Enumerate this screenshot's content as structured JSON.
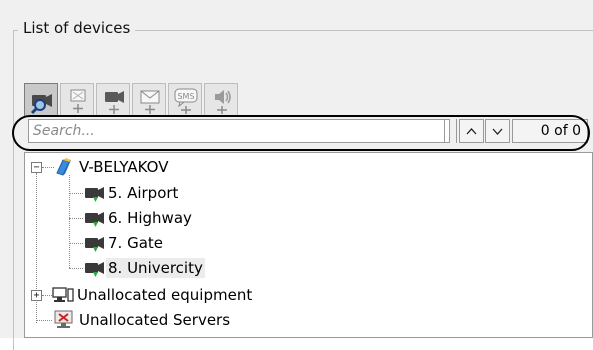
{
  "panel": {
    "title": "List of devices"
  },
  "toolbar": {
    "buttons": [
      {
        "name": "find-camera-button",
        "icon": "camera-search-icon",
        "selected": true
      },
      {
        "name": "add-ip-device-button",
        "icon": "add-ip-device-icon"
      },
      {
        "name": "add-camera-button",
        "icon": "add-camera-icon"
      },
      {
        "name": "add-email-button",
        "icon": "add-email-icon"
      },
      {
        "name": "add-sms-button",
        "icon": "add-sms-icon"
      },
      {
        "name": "add-speaker-button",
        "icon": "add-speaker-icon"
      }
    ]
  },
  "search": {
    "placeholder": "Search...",
    "value": "",
    "counter": "0 of 0"
  },
  "tree": {
    "server": {
      "label": "V-BELYAKOV"
    },
    "cameras": [
      {
        "label": "5. Airport"
      },
      {
        "label": "6. Highway"
      },
      {
        "label": "7. Gate"
      },
      {
        "label": "8. Univercity"
      }
    ],
    "unallocated_equipment": {
      "label": "Unallocated equipment"
    },
    "unallocated_servers": {
      "label": "Unallocated Servers"
    }
  }
}
